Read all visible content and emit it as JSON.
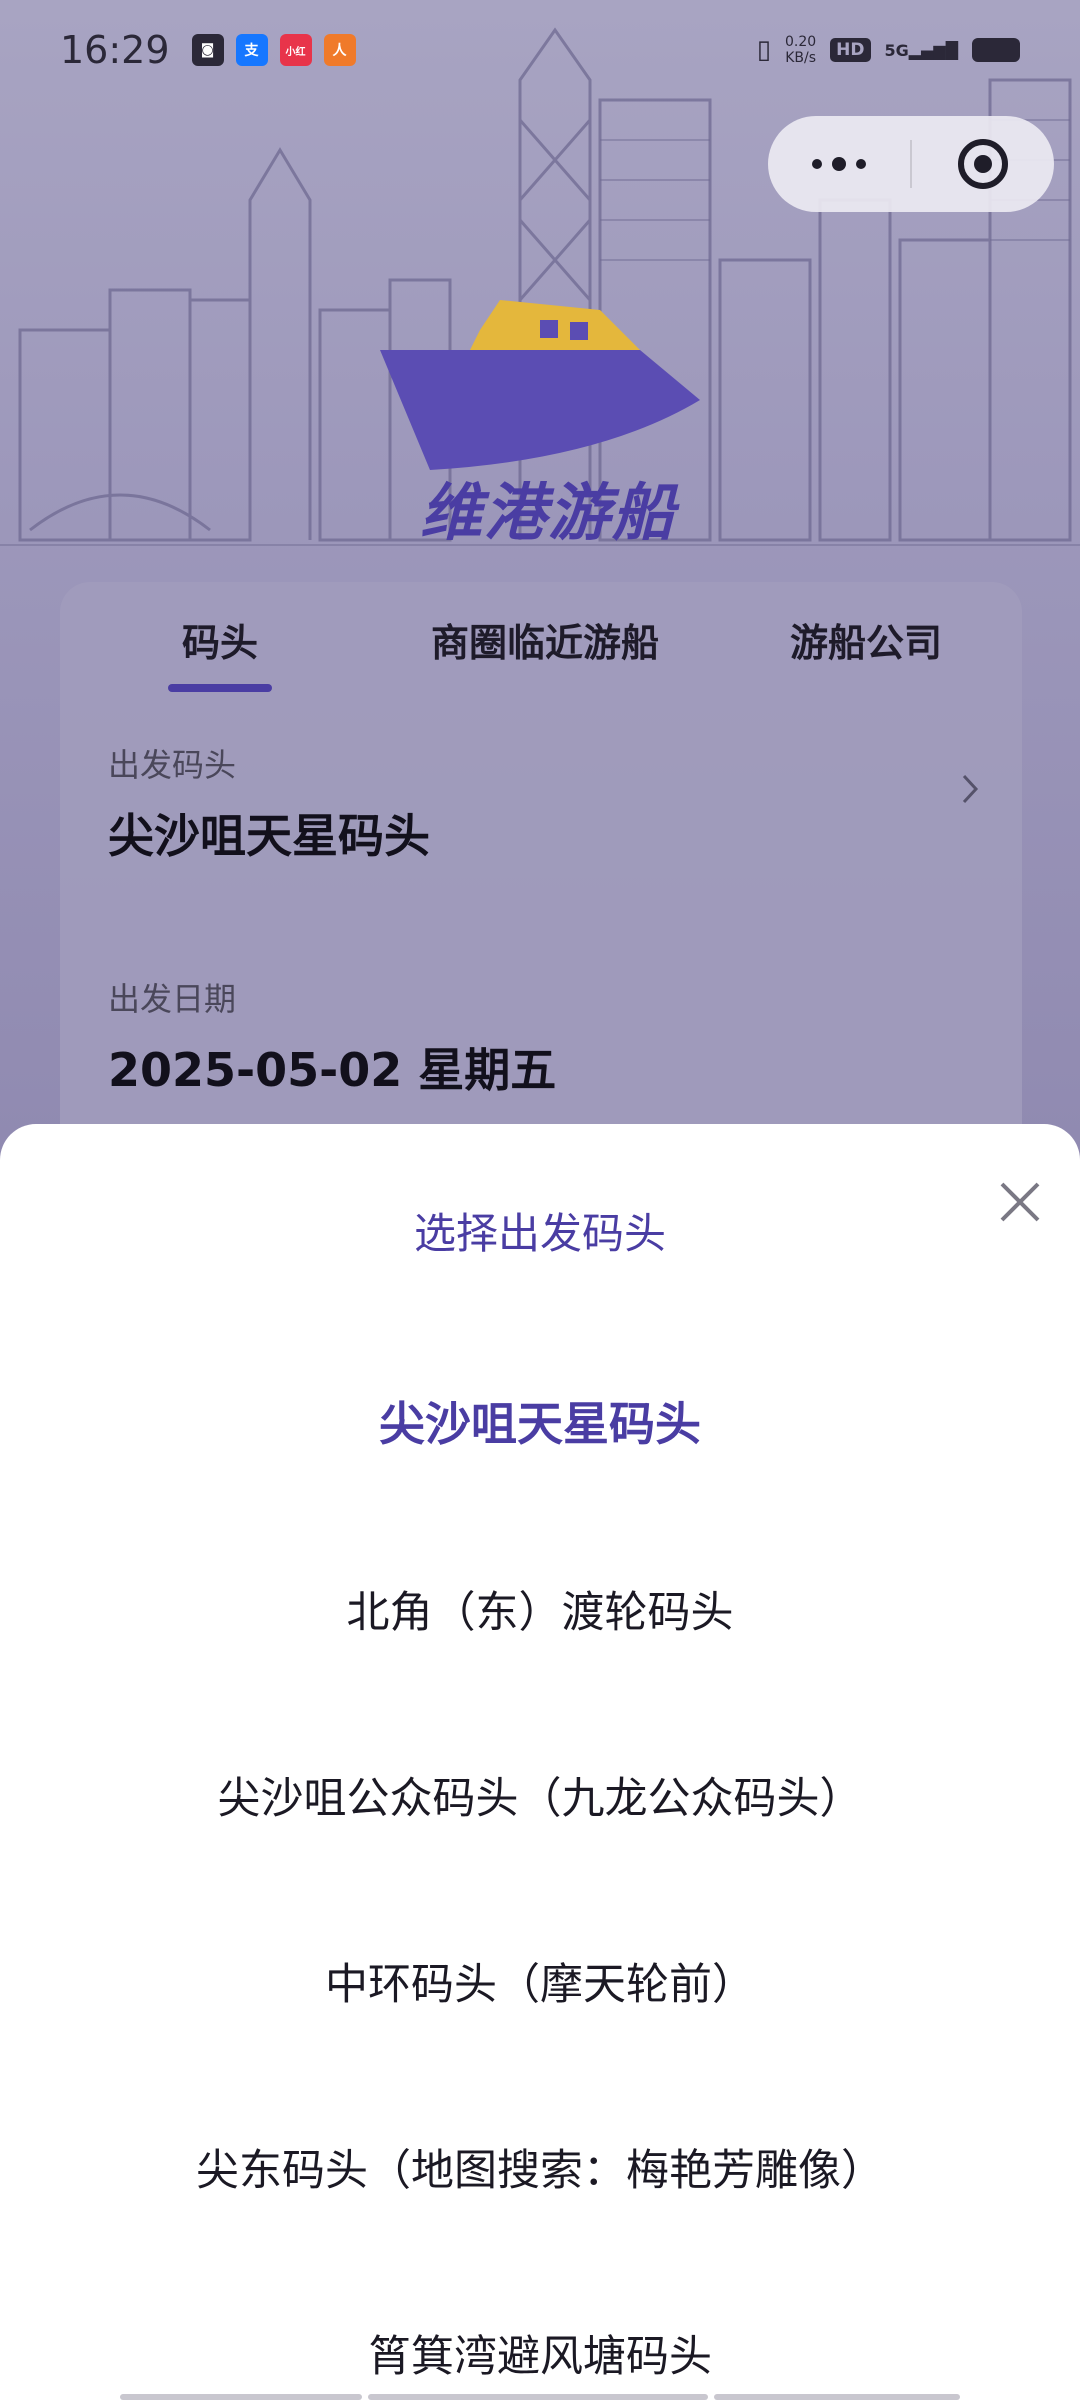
{
  "status_bar": {
    "time": "16:29",
    "app_icons": [
      {
        "name": "notification-icon-1",
        "color": "#2b2838",
        "glyph": "☺"
      },
      {
        "name": "alipay-icon",
        "color": "#1677ff",
        "glyph": "支"
      },
      {
        "name": "app-icon-red",
        "color": "#e8344a",
        "glyph": "小红"
      },
      {
        "name": "app-icon-orange",
        "color": "#f07a2a",
        "glyph": "人"
      }
    ],
    "net_speed_value": "0.20",
    "net_speed_unit": "KB/s",
    "hd": "HD",
    "signal": "5G"
  },
  "header": {
    "logo_text": "维港游船"
  },
  "tabs": [
    {
      "label": "码头",
      "active": true
    },
    {
      "label": "商圈临近游船",
      "active": false
    },
    {
      "label": "游船公司",
      "active": false
    }
  ],
  "form": {
    "departure_pier_label": "出发码头",
    "departure_pier_value": "尖沙咀天星码头",
    "departure_date_label": "出发日期",
    "departure_date_value": "2025-05-02 星期五"
  },
  "sheet": {
    "title": "选择出发码头",
    "options": [
      {
        "label": "尖沙咀天星码头",
        "selected": true
      },
      {
        "label": "北角（东）渡轮码头",
        "selected": false
      },
      {
        "label": "尖沙咀公众码头（九龙公众码头）",
        "selected": false
      },
      {
        "label": "中环码头（摩天轮前）",
        "selected": false
      },
      {
        "label": "尖东码头（地图搜索：梅艳芳雕像）",
        "selected": false
      },
      {
        "label": "筲箕湾避风塘码头",
        "selected": false
      }
    ]
  },
  "colors": {
    "accent": "#4a3da3",
    "text": "#1b1924",
    "overlay": "#8d88a8"
  }
}
